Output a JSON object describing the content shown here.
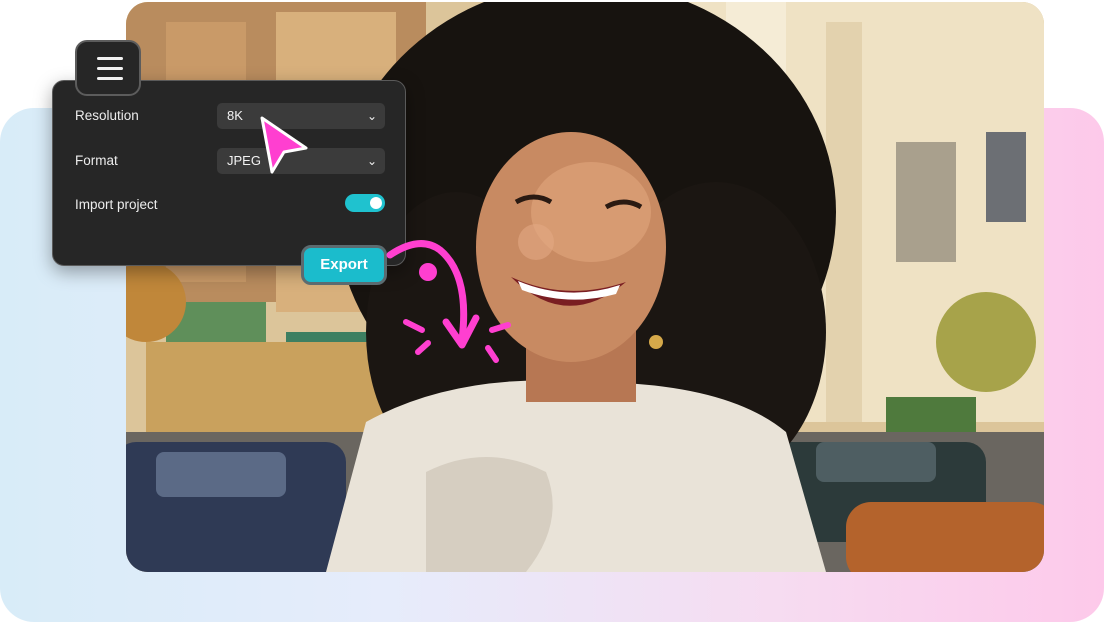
{
  "settings_panel": {
    "rows": [
      {
        "label": "Resolution",
        "value": "8K",
        "type": "select"
      },
      {
        "label": "Format",
        "value": "JPEG",
        "type": "select"
      },
      {
        "label": "Import project",
        "type": "toggle",
        "enabled": true
      }
    ]
  },
  "export_button": {
    "label": "Export"
  },
  "icons": {
    "menu": "hamburger-menu-icon",
    "dropdown": "chevron-down-icon",
    "pointer": "cursor-arrow-icon",
    "arrow": "curved-arrow-icon"
  },
  "colors": {
    "accent": "#1fc2cf",
    "panel_bg": "#262626",
    "highlight": "#ff3fd0"
  }
}
